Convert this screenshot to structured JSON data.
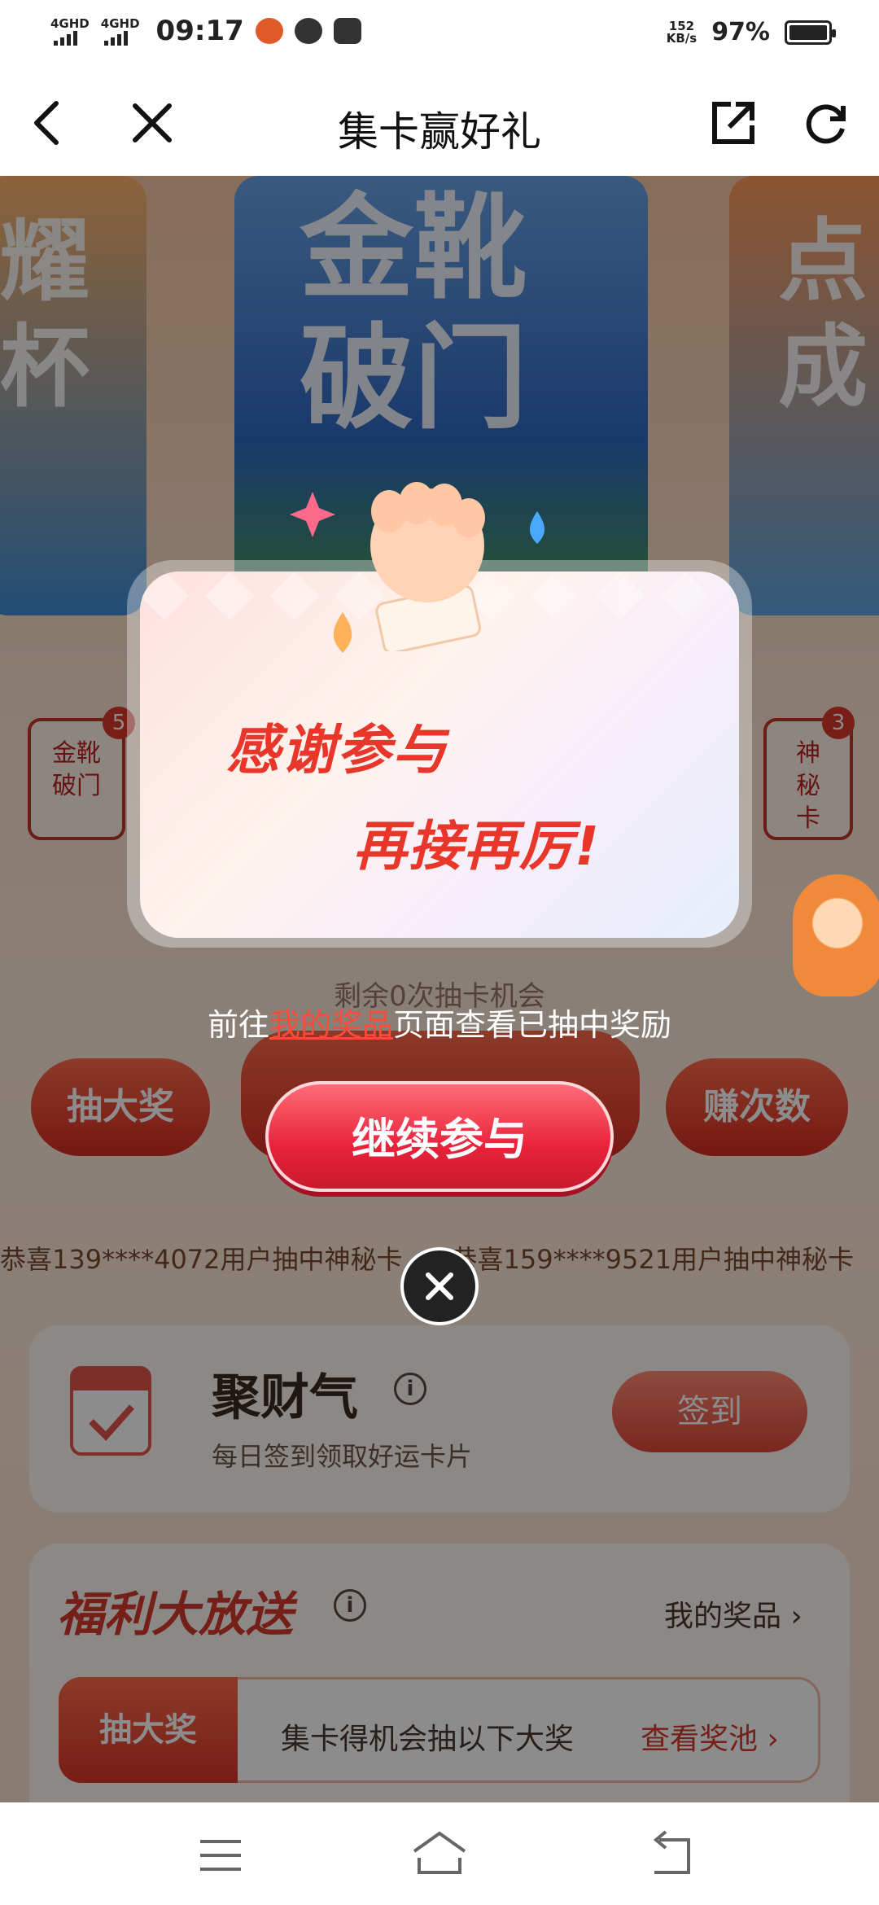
{
  "status_bar": {
    "signal1": "4GHD",
    "signal2": "4GHD",
    "time": "09:17",
    "speed_value": "152",
    "speed_unit": "KB/s",
    "battery": "97%"
  },
  "nav": {
    "title": "集卡赢好礼"
  },
  "background": {
    "hero_left": "耀杯",
    "hero_center": "金靴破门",
    "hero_right": "点成",
    "tab_left_label": "金靴破门",
    "tab_left_count": "5",
    "tab_right_label": "神秘卡",
    "tab_right_count": "3",
    "btn_left": "抽大奖",
    "btn_right": "赚次数",
    "marquee": [
      "恭喜139****4072用户抽中神秘卡",
      "恭喜159****9521用户抽中神秘卡"
    ],
    "sign_panel": {
      "title": "聚财气",
      "subtitle": "每日签到领取好运卡片",
      "button": "签到"
    },
    "welfare": {
      "title": "福利大放送",
      "my_prizes_link": "我的奖品 ›",
      "tab_label": "抽大奖",
      "tab_desc": "集卡得机会抽以下大奖",
      "tab_link": "查看奖池 ›"
    }
  },
  "modal": {
    "line1": "感谢参与",
    "line2": "再接再厉!",
    "remain_text": "剩余0次抽卡机会",
    "hint_prefix": "前往",
    "hint_link": "我的奖品",
    "hint_suffix": "页面查看已抽中奖励",
    "continue_button": "继续参与"
  },
  "colors": {
    "accent": "#e8223a",
    "modal_text": "#e8372a"
  }
}
